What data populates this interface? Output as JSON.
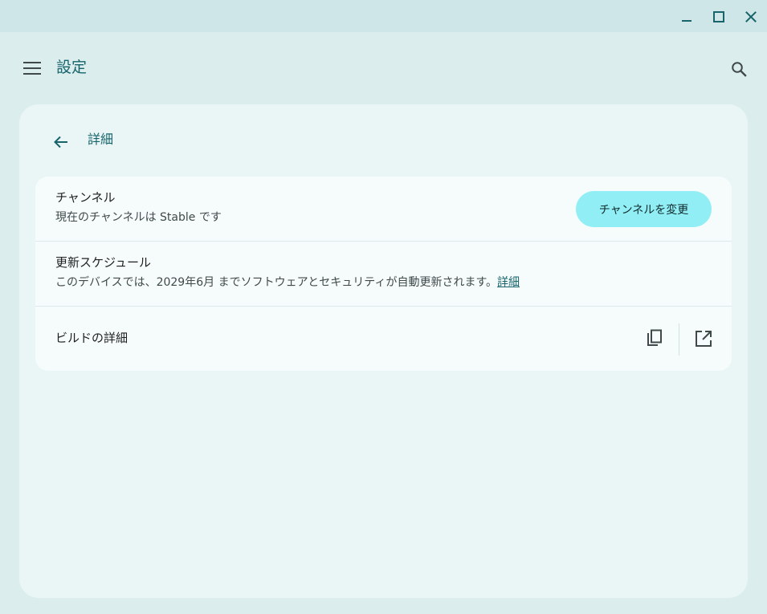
{
  "app": {
    "title": "設定"
  },
  "subpage": {
    "title": "詳細"
  },
  "rows": {
    "channel": {
      "title": "チャンネル",
      "subtitle": "現在のチャンネルは Stable です",
      "button_label": "チャンネルを変更"
    },
    "update_schedule": {
      "title": "更新スケジュール",
      "subtitle": "このデバイスでは、2029年6月 までソフトウェアとセキュリティが自動更新されます。",
      "link_label": "詳細"
    },
    "build_details": {
      "title": "ビルドの詳細"
    }
  },
  "icons": {
    "minimize": "minimize-icon",
    "maximize": "maximize-icon",
    "close": "close-icon",
    "menu": "menu-icon",
    "search": "search-icon",
    "back": "arrow-back-icon",
    "copy": "copy-icon",
    "open_external": "open-in-new-icon"
  },
  "colors": {
    "accent": "#17656b",
    "button_bg": "#92eef5",
    "panel_bg": "#eaf6f6",
    "card_bg": "#f6fcfc"
  }
}
